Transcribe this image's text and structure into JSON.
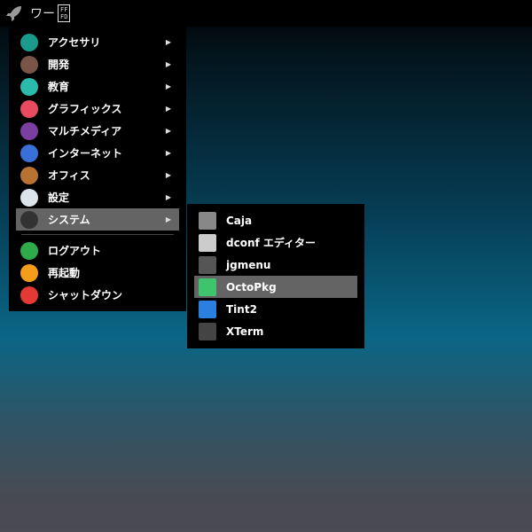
{
  "panel": {
    "title": "ワー",
    "box_top": "FF",
    "box_bottom": "FD"
  },
  "main_menu": {
    "items": [
      {
        "label": "アクセサリ",
        "icon": "accessories-icon",
        "color": "#1a9a8a"
      },
      {
        "label": "開発",
        "icon": "development-icon",
        "color": "#795548"
      },
      {
        "label": "教育",
        "icon": "education-icon",
        "color": "#2bbbad"
      },
      {
        "label": "グラフィックス",
        "icon": "graphics-icon",
        "color": "#e84a5f"
      },
      {
        "label": "マルチメディア",
        "icon": "multimedia-icon",
        "color": "#7b3fa0"
      },
      {
        "label": "インターネット",
        "icon": "internet-icon",
        "color": "#3a6fd8"
      },
      {
        "label": "オフィス",
        "icon": "office-icon",
        "color": "#b87333"
      },
      {
        "label": "設定",
        "icon": "settings-icon",
        "color": "#dde3ea"
      },
      {
        "label": "システム",
        "icon": "system-icon",
        "color": "#333"
      }
    ],
    "actions": [
      {
        "label": "ログアウト",
        "icon": "logout-icon",
        "color": "#2eaa4a"
      },
      {
        "label": "再起動",
        "icon": "reboot-icon",
        "color": "#f59c1a"
      },
      {
        "label": "シャットダウン",
        "icon": "shutdown-icon",
        "color": "#e53935"
      }
    ],
    "arrow": "▶"
  },
  "sub_menu": {
    "items": [
      {
        "label": "Caja",
        "icon": "caja-icon",
        "color": "#888"
      },
      {
        "label": "dconf エディター",
        "icon": "dconf-icon",
        "color": "#ccc"
      },
      {
        "label": "jgmenu",
        "icon": "rocket-icon",
        "color": "#555"
      },
      {
        "label": "OctoPkg",
        "icon": "octopkg-icon",
        "color": "#3ec46d"
      },
      {
        "label": "Tint2",
        "icon": "tint2-icon",
        "color": "#2a7fe0"
      },
      {
        "label": "XTerm",
        "icon": "terminal-icon",
        "color": "#444"
      }
    ]
  }
}
